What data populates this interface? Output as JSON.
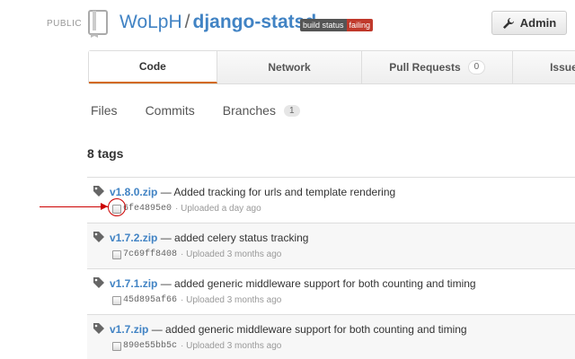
{
  "header": {
    "visibility": "PUBLIC",
    "owner": "WoLpH",
    "separator": "/",
    "repo": "django-statsd",
    "build_label": "build status",
    "build_status": "failing",
    "build_status_color": "#c0392b",
    "admin_label": "Admin"
  },
  "tabs": [
    {
      "label": "Code",
      "selected": true
    },
    {
      "label": "Network"
    },
    {
      "label": "Pull Requests",
      "count": "0"
    },
    {
      "label": "Issues"
    }
  ],
  "subnav": {
    "files": "Files",
    "commits": "Commits",
    "branches": "Branches",
    "branches_count": "1"
  },
  "tags_heading": "8 tags",
  "tags": [
    {
      "name": "v1.8.0.zip",
      "message": "— Added tracking for urls and template rendering",
      "sha": "6fe4895e0",
      "uploaded": "· Uploaded a day ago"
    },
    {
      "name": "v1.7.2.zip",
      "message": "— added celery status tracking",
      "sha": "7c69ff8408",
      "uploaded": "· Uploaded 3 months ago"
    },
    {
      "name": "v1.7.1.zip",
      "message": "— added generic middleware support for both counting and timing",
      "sha": "45d895af66",
      "uploaded": "· Uploaded 3 months ago"
    },
    {
      "name": "v1.7.zip",
      "message": "— added generic middleware support for both counting and timing",
      "sha": "890e55bb5c",
      "uploaded": "· Uploaded 3 months ago"
    }
  ],
  "colors": {
    "accent": "#4183c4",
    "selected_tab_underline": "#d26911",
    "annotation": "#cc0000"
  }
}
